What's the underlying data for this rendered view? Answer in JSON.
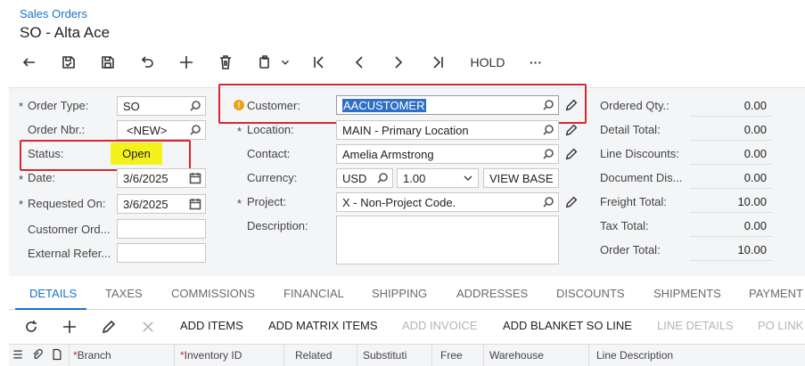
{
  "header": {
    "breadcrumb": "Sales Orders",
    "title": "SO - Alta Ace"
  },
  "toolbar": {
    "hold_label": "HOLD",
    "more_label": "···"
  },
  "form": {
    "order_type": {
      "label": "Order Type:",
      "value": "SO"
    },
    "order_nbr": {
      "label": "Order Nbr.:",
      "value": "<NEW>"
    },
    "status": {
      "label": "Status:",
      "value": "Open"
    },
    "date": {
      "label": "Date:",
      "value": "3/6/2025"
    },
    "requested_on": {
      "label": "Requested On:",
      "value": "3/6/2025"
    },
    "customer_order": {
      "label": "Customer Ord...",
      "value": ""
    },
    "external_ref": {
      "label": "External Refer...",
      "value": ""
    },
    "customer": {
      "label": "Customer:",
      "value": "AACUSTOMER"
    },
    "location": {
      "label": "Location:",
      "value": "MAIN - Primary Location"
    },
    "contact": {
      "label": "Contact:",
      "value": "Amelia Armstrong"
    },
    "currency": {
      "label": "Currency:",
      "value": "USD",
      "rate": "1.00",
      "view_base": "VIEW BASE"
    },
    "project": {
      "label": "Project:",
      "value": "X - Non-Project Code."
    },
    "description": {
      "label": "Description:",
      "value": ""
    },
    "required_mark": "*"
  },
  "totals": [
    {
      "label": "Ordered Qty.:",
      "value": "0.00"
    },
    {
      "label": "Detail Total:",
      "value": "0.00"
    },
    {
      "label": "Line Discounts:",
      "value": "0.00"
    },
    {
      "label": "Document Dis...",
      "value": "0.00"
    },
    {
      "label": "Freight Total:",
      "value": "10.00"
    },
    {
      "label": "Tax Total:",
      "value": "0.00"
    },
    {
      "label": "Order Total:",
      "value": "10.00"
    }
  ],
  "tabs": [
    {
      "label": "DETAILS"
    },
    {
      "label": "TAXES"
    },
    {
      "label": "COMMISSIONS"
    },
    {
      "label": "FINANCIAL"
    },
    {
      "label": "SHIPPING"
    },
    {
      "label": "ADDRESSES"
    },
    {
      "label": "DISCOUNTS"
    },
    {
      "label": "SHIPMENTS"
    },
    {
      "label": "PAYMENT"
    }
  ],
  "grid_toolbar": {
    "add_items": "ADD ITEMS",
    "add_matrix_items": "ADD MATRIX ITEMS",
    "add_invoice": "ADD INVOICE",
    "add_blanket_so_line": "ADD BLANKET SO LINE",
    "line_details": "LINE DETAILS",
    "po_link": "PO LINK"
  },
  "grid_columns": [
    {
      "label": "Branch",
      "required": "*"
    },
    {
      "label": "Inventory ID",
      "required": "*"
    },
    {
      "label": "Related"
    },
    {
      "label": "Substituti"
    },
    {
      "label": "Free"
    },
    {
      "label": "Warehouse"
    },
    {
      "label": "Line Description"
    }
  ],
  "colors": {
    "accent": "#1a73c5",
    "highlight_box": "#d9262f",
    "status_highlight": "#f3f21a",
    "selection": "#2f6fc6",
    "warning": "#e8a317"
  }
}
